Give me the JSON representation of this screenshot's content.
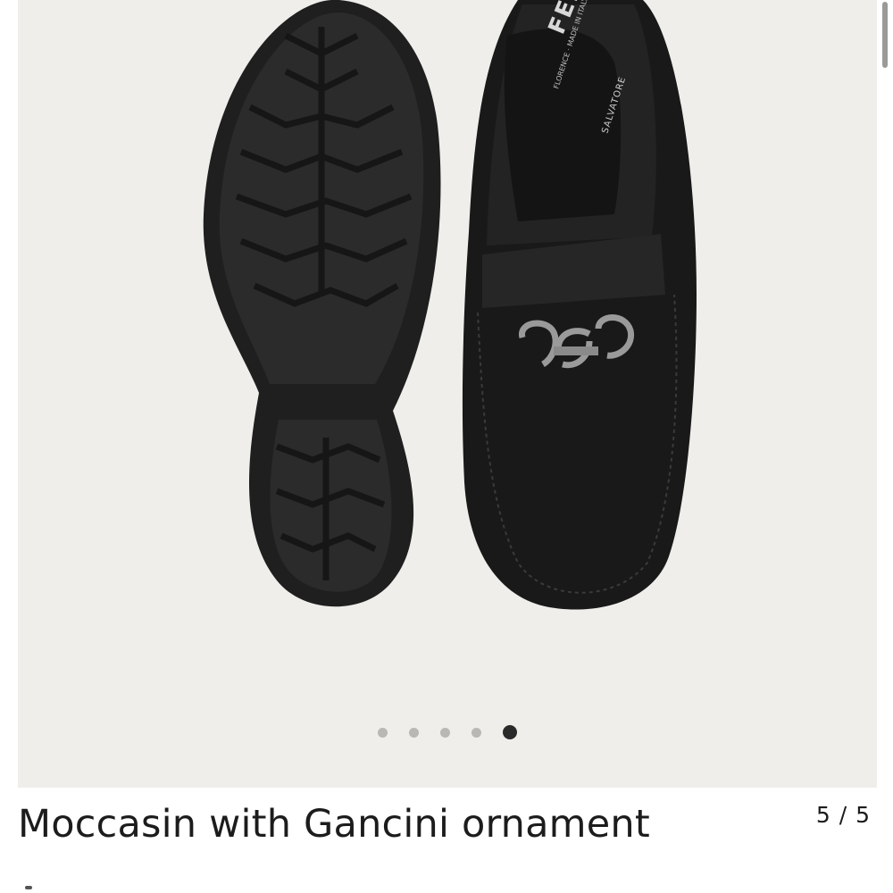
{
  "product": {
    "title": "Moccasin with Gancini ornament",
    "brand_logo_text": "FERRAGAMO",
    "brand_sub_text": "SALVATORE",
    "origin_text": "FLORENCE · MADE IN ITALY",
    "sole_signature": "Salvatore Ferragamo"
  },
  "gallery": {
    "counter": "5 / 5",
    "current": 5,
    "total": 5,
    "slides": [
      "slide-1",
      "slide-2",
      "slide-3",
      "slide-4",
      "slide-5"
    ],
    "background": "#efeeeb",
    "active_dot_color": "#2a2a2a",
    "inactive_dot_color": "#b9b8b5"
  },
  "icons": {
    "scrollbar": "scrollbar-thumb"
  }
}
